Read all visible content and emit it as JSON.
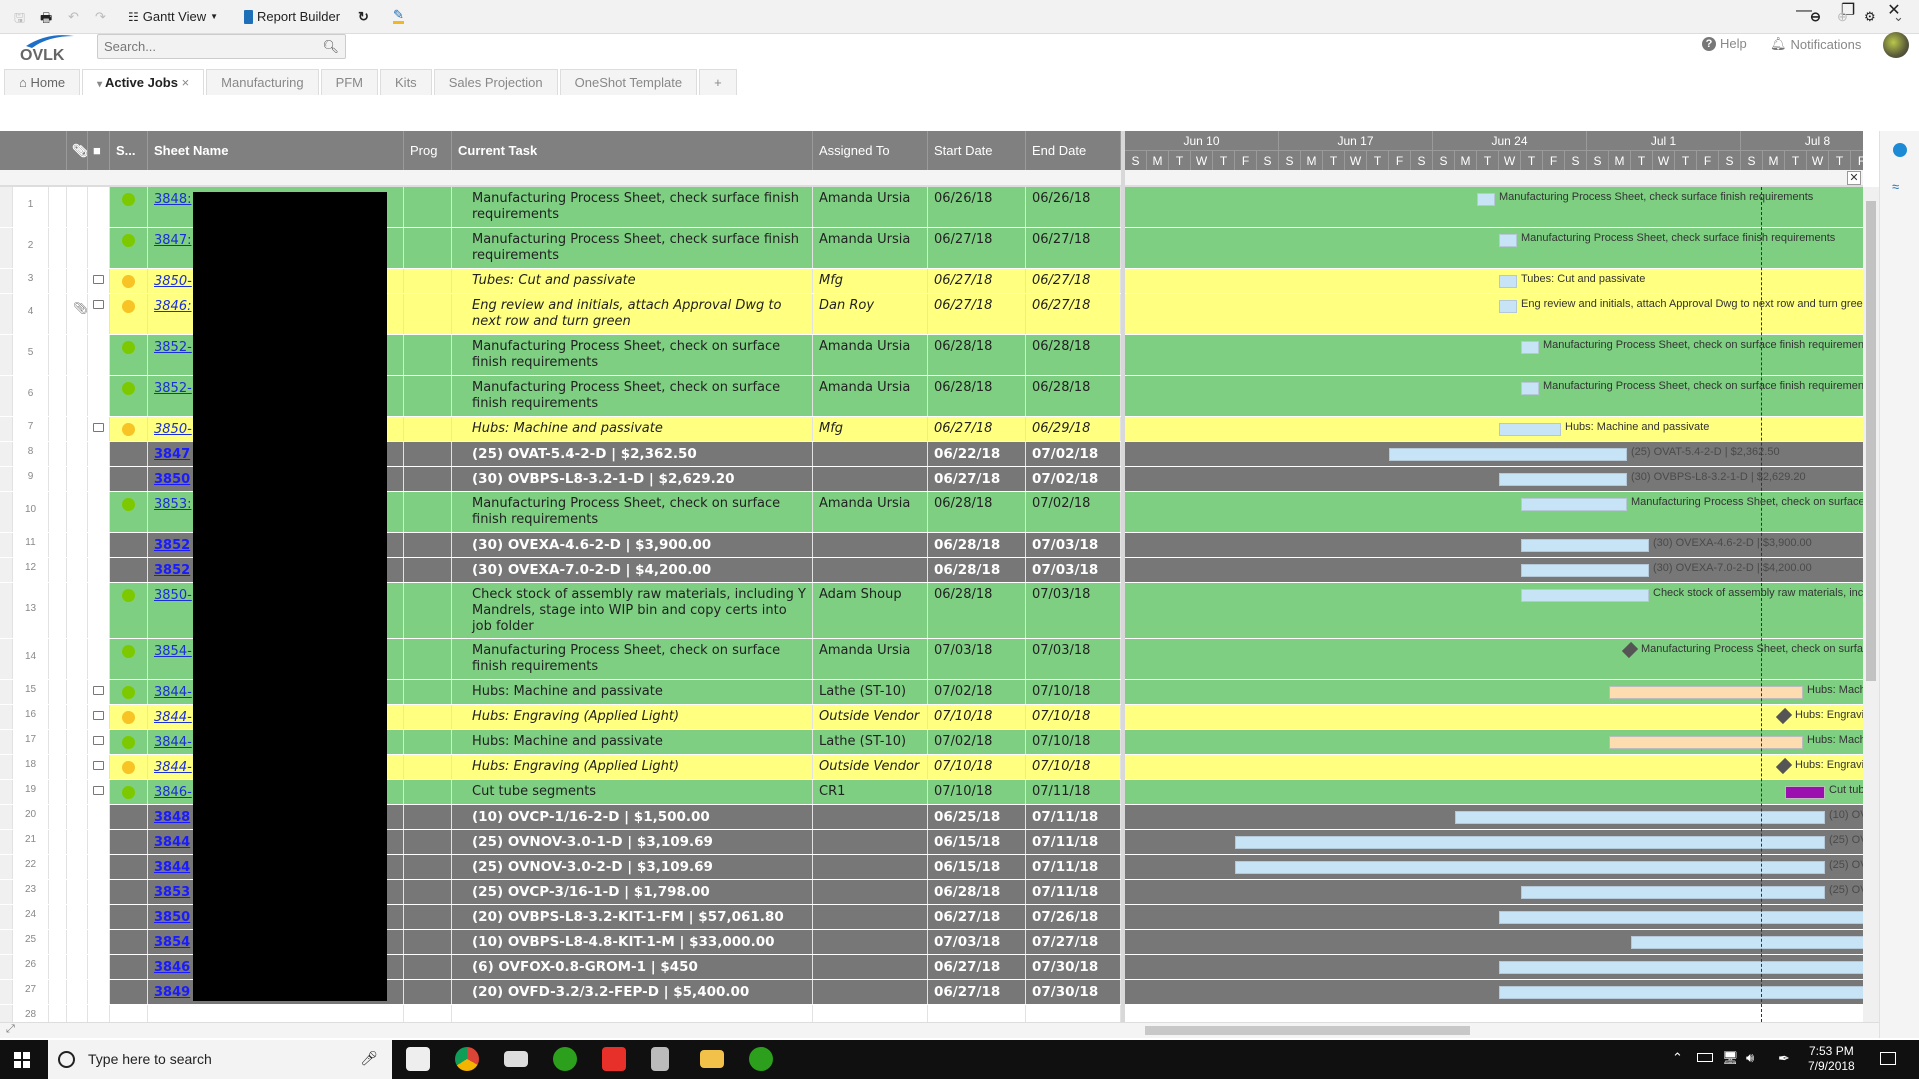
{
  "app": {
    "logo_text": "OVLK",
    "search_placeholder": "Search...",
    "help": "Help",
    "notifications": "Notifications"
  },
  "tabs": [
    {
      "label": "Home",
      "icon": "home-icon"
    },
    {
      "label": "Active Jobs",
      "active": true
    },
    {
      "label": "Manufacturing"
    },
    {
      "label": "PFM"
    },
    {
      "label": "Kits"
    },
    {
      "label": "Sales Projection"
    },
    {
      "label": "OneShot Template"
    },
    {
      "label": "+"
    }
  ],
  "toolbar": {
    "gantt_view": "Gantt View",
    "report_builder": "Report Builder"
  },
  "columns": {
    "status": "S...",
    "sheet_name": "Sheet Name",
    "prog": "Prog",
    "current_task": "Current Task",
    "assigned_to": "Assigned To",
    "start_date": "Start Date",
    "end_date": "End Date"
  },
  "gantt": {
    "months": [
      "Jun 10",
      "Jun 17",
      "Jun 24",
      "Jul 1",
      "Jul 8"
    ],
    "days": [
      "S",
      "M",
      "T",
      "W",
      "T",
      "F",
      "S"
    ],
    "today": "7/9/2018"
  },
  "colors": {
    "green_row": "#7ecf82",
    "yellow_row": "#ffff80",
    "grey_row": "#777777",
    "status_green": "#7dc900",
    "status_yellow": "#f7c325",
    "bar_blue": "#c7e4f7",
    "bar_peach": "#fddcb0",
    "bar_purple": "#9b0fb0"
  },
  "rows": [
    {
      "n": "1",
      "type": "green",
      "status": "green",
      "sheet": "3848:",
      "task": "Manufacturing Process Sheet, check surface finish requirements",
      "assigned": "Amanda Ursia",
      "start": "06/26/18",
      "end": "06/26/18",
      "lines": 2
    },
    {
      "n": "2",
      "type": "green",
      "status": "green",
      "sheet": "3847:",
      "task": "Manufacturing Process Sheet, check surface finish requirements",
      "assigned": "Amanda Ursia",
      "start": "06/27/18",
      "end": "06/27/18",
      "lines": 2
    },
    {
      "n": "3",
      "type": "yellow",
      "status": "yellow",
      "comment": true,
      "sheet": "3850-",
      "task": "Tubes: Cut and passivate",
      "assigned": "Mfg",
      "start": "06/27/18",
      "end": "06/27/18",
      "lines": 1
    },
    {
      "n": "4",
      "type": "yellow",
      "status": "yellow",
      "attach": true,
      "comment": true,
      "sheet": "3846:",
      "task": "Eng review and initials, attach Approval Dwg to next row and turn green",
      "assigned": "Dan Roy",
      "start": "06/27/18",
      "end": "06/27/18",
      "lines": 2
    },
    {
      "n": "5",
      "type": "green",
      "status": "green",
      "sheet": "3852-",
      "task": "Manufacturing Process Sheet, check on surface finish requirements",
      "assigned": "Amanda Ursia",
      "start": "06/28/18",
      "end": "06/28/18",
      "lines": 2
    },
    {
      "n": "6",
      "type": "green",
      "status": "green",
      "sheet": "3852-",
      "task": "Manufacturing Process Sheet, check on surface finish requirements",
      "assigned": "Amanda Ursia",
      "start": "06/28/18",
      "end": "06/28/18",
      "lines": 2
    },
    {
      "n": "7",
      "type": "yellow",
      "status": "yellow",
      "comment": true,
      "sheet": "3850-",
      "task": "Hubs: Machine and passivate",
      "assigned": "Mfg",
      "start": "06/27/18",
      "end": "06/29/18",
      "lines": 1
    },
    {
      "n": "8",
      "type": "grey",
      "sheet": "3847",
      "task": "(25) OVAT-5.4-2-D | $2,362.50",
      "assigned": "",
      "start": "06/22/18",
      "end": "07/02/18",
      "lines": 1
    },
    {
      "n": "9",
      "type": "grey",
      "sheet": "3850",
      "task": "(30) OVBPS-L8-3.2-1-D | $2,629.20",
      "assigned": "",
      "start": "06/27/18",
      "end": "07/02/18",
      "lines": 1
    },
    {
      "n": "10",
      "type": "green",
      "status": "green",
      "sheet": "3853:",
      "task": "Manufacturing Process Sheet, check on surface finish requirements",
      "assigned": "Amanda Ursia",
      "start": "06/28/18",
      "end": "07/02/18",
      "lines": 2
    },
    {
      "n": "11",
      "type": "grey",
      "sheet": "3852",
      "task": "(30) OVEXA-4.6-2-D | $3,900.00",
      "assigned": "",
      "start": "06/28/18",
      "end": "07/03/18",
      "lines": 1
    },
    {
      "n": "12",
      "type": "grey",
      "sheet": "3852",
      "task": "(30) OVEXA-7.0-2-D | $4,200.00",
      "assigned": "",
      "start": "06/28/18",
      "end": "07/03/18",
      "lines": 1
    },
    {
      "n": "13",
      "type": "green",
      "status": "green",
      "sheet": "3850-",
      "task": "Check stock of assembly raw materials, including Y Mandrels, stage into WIP bin and copy certs into job folder",
      "assigned": "Adam Shoup",
      "start": "06/28/18",
      "end": "07/03/18",
      "lines": 3
    },
    {
      "n": "14",
      "type": "green",
      "status": "green",
      "sheet": "3854-",
      "task": "Manufacturing Process Sheet, check on surface finish requirements",
      "assigned": "Amanda Ursia",
      "start": "07/03/18",
      "end": "07/03/18",
      "lines": 2,
      "milestone": true
    },
    {
      "n": "15",
      "type": "green",
      "status": "green",
      "comment": true,
      "sheet": "3844-",
      "task": "Hubs: Machine and passivate",
      "assigned": "Lathe (ST-10)",
      "start": "07/02/18",
      "end": "07/10/18",
      "lines": 1,
      "bar": "peach"
    },
    {
      "n": "16",
      "type": "yellow",
      "status": "yellow",
      "comment": true,
      "sheet": "3844-",
      "task": "Hubs: Engraving (Applied Light)",
      "assigned": "Outside Vendor",
      "start": "07/10/18",
      "end": "07/10/18",
      "lines": 1,
      "milestone": true
    },
    {
      "n": "17",
      "type": "green",
      "status": "green",
      "comment": true,
      "sheet": "3844-",
      "task": "Hubs: Machine and passivate",
      "assigned": "Lathe (ST-10)",
      "start": "07/02/18",
      "end": "07/10/18",
      "lines": 1,
      "bar": "peach"
    },
    {
      "n": "18",
      "type": "yellow",
      "status": "yellow",
      "comment": true,
      "sheet": "3844-",
      "task": "Hubs: Engraving (Applied Light)",
      "assigned": "Outside Vendor",
      "start": "07/10/18",
      "end": "07/10/18",
      "lines": 1,
      "milestone": true
    },
    {
      "n": "19",
      "type": "green",
      "status": "green",
      "comment": true,
      "sheet": "3846-",
      "task": "Cut tube segments",
      "assigned": "CR1",
      "start": "07/10/18",
      "end": "07/11/18",
      "lines": 1,
      "bar": "purple"
    },
    {
      "n": "20",
      "type": "grey",
      "sheet": "3848",
      "task": "(10) OVCP-1/16-2-D | $1,500.00",
      "assigned": "",
      "start": "06/25/18",
      "end": "07/11/18",
      "lines": 1
    },
    {
      "n": "21",
      "type": "grey",
      "sheet": "3844",
      "task": "(25) OVNOV-3.0-1-D | $3,109.69",
      "assigned": "",
      "start": "06/15/18",
      "end": "07/11/18",
      "lines": 1
    },
    {
      "n": "22",
      "type": "grey",
      "sheet": "3844",
      "task": "(25) OVNOV-3.0-2-D | $3,109.69",
      "assigned": "",
      "start": "06/15/18",
      "end": "07/11/18",
      "lines": 1
    },
    {
      "n": "23",
      "type": "grey",
      "sheet": "3853",
      "task": "(25) OVCP-3/16-1-D | $1,798.00",
      "assigned": "",
      "start": "06/28/18",
      "end": "07/11/18",
      "lines": 1
    },
    {
      "n": "24",
      "type": "grey",
      "sheet": "3850",
      "task": "(20) OVBPS-L8-3.2-KIT-1-FM | $57,061.80",
      "assigned": "",
      "start": "06/27/18",
      "end": "07/26/18",
      "lines": 1
    },
    {
      "n": "25",
      "type": "grey",
      "sheet": "3854",
      "task": "(10) OVBPS-L8-4.8-KIT-1-M | $33,000.00",
      "assigned": "",
      "start": "07/03/18",
      "end": "07/27/18",
      "lines": 1
    },
    {
      "n": "26",
      "type": "grey",
      "sheet": "3846",
      "task": "(6) OVFOX-0.8-GROM-1 | $450",
      "assigned": "",
      "start": "06/27/18",
      "end": "07/30/18",
      "lines": 1
    },
    {
      "n": "27",
      "type": "grey",
      "sheet": "3849",
      "task": "(20) OVFD-3.2/3.2-FEP-D | $5,400.00",
      "assigned": "",
      "start": "06/27/18",
      "end": "07/30/18",
      "lines": 1
    },
    {
      "n": "28",
      "type": "empty",
      "lines": 1
    }
  ],
  "taskbar": {
    "search_placeholder": "Type here to search",
    "time": "7:53 PM",
    "date": "7/9/2018"
  }
}
